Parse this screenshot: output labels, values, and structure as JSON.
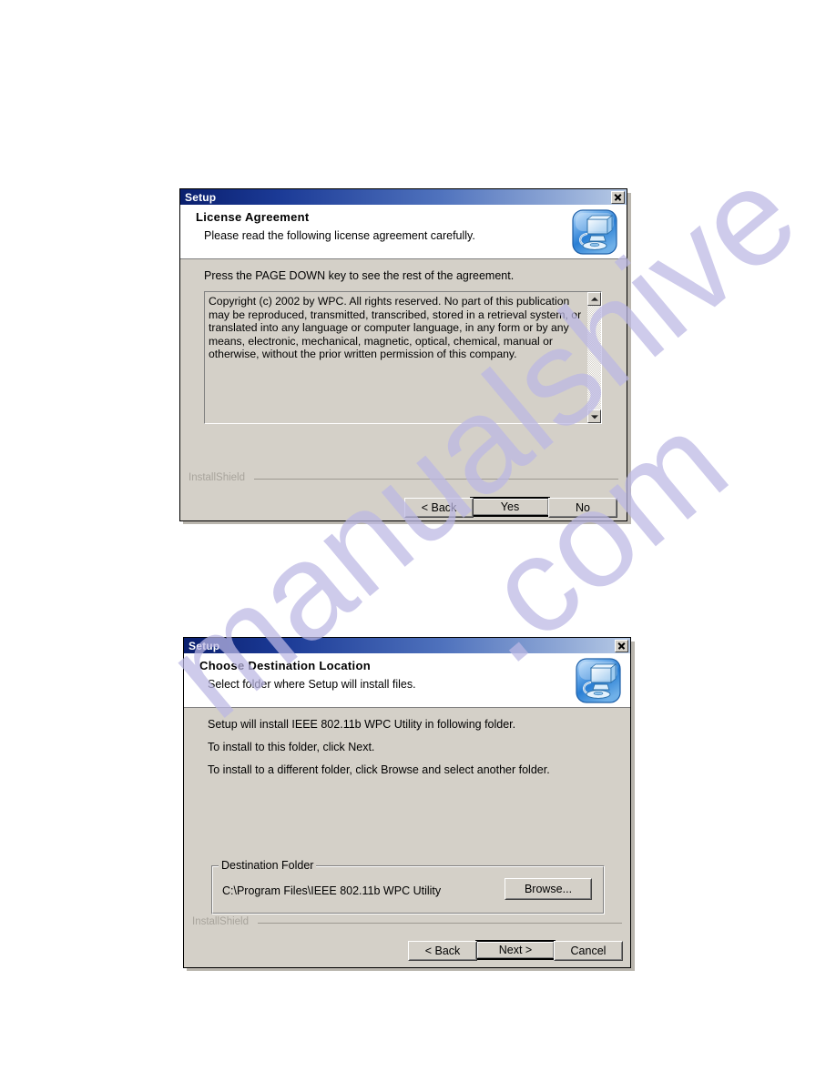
{
  "page": {
    "background": "#ffffff",
    "watermark": {
      "line1": "manualshive",
      "line2": ".com",
      "color": "#bcb8e4"
    }
  },
  "theme": {
    "dialog_face": "#d4d0c8",
    "titlebar_start": "#0a1f6e",
    "titlebar_end": "#b8cbe6",
    "header_panel": "#ffffff",
    "text": "#000000",
    "installshield_label_color": "#a8a49c"
  },
  "dialogs": [
    {
      "id": "license-agreement",
      "titlebar": {
        "title": "Setup",
        "close_label": "x",
        "close_icon": "close-icon"
      },
      "header": {
        "title": "License Agreement",
        "subtitle": "Please read the following license agreement carefully.",
        "icon": "setup-installer-icon"
      },
      "body": {
        "instruction": "Press the PAGE DOWN key to see the rest of the agreement.",
        "license_text": "Copyright (c) 2002 by WPC. All rights reserved. No part of this publication may be reproduced, transmitted, transcribed, stored in a retrieval system, or translated into any language or computer language, in any form or by any means, electronic, mechanical, magnetic, optical, chemical, manual or otherwise, without the prior written permission of this company.",
        "scrollbar": {
          "up_icon": "scroll-up-arrow-icon",
          "down_icon": "scroll-down-arrow-icon"
        }
      },
      "footer": {
        "brand": "InstallShield",
        "buttons": [
          {
            "label": "< Back",
            "name": "back-button",
            "default": false
          },
          {
            "label": "Yes",
            "name": "yes-button",
            "default": true
          },
          {
            "label": "No",
            "name": "no-button",
            "default": false
          }
        ]
      }
    },
    {
      "id": "choose-destination-location",
      "titlebar": {
        "title": "Setup",
        "close_label": "x",
        "close_icon": "close-icon"
      },
      "header": {
        "title": "Choose Destination Location",
        "subtitle": "Select folder where Setup will install files.",
        "icon": "setup-installer-icon"
      },
      "body": {
        "line1": "Setup will install IEEE 802.11b WPC Utility in following folder.",
        "line2": "To install to this folder, click Next.",
        "line3": "To install to a different folder, click Browse and select another folder.",
        "group": {
          "legend": "Destination Folder",
          "path": "C:\\Program Files\\IEEE 802.11b WPC Utility",
          "browse_label": "Browse..."
        }
      },
      "footer": {
        "brand": "InstallShield",
        "buttons": [
          {
            "label": "< Back",
            "name": "back-button",
            "default": false
          },
          {
            "label": "Next >",
            "name": "next-button",
            "default": true
          },
          {
            "label": "Cancel",
            "name": "cancel-button",
            "default": false
          }
        ]
      }
    }
  ]
}
